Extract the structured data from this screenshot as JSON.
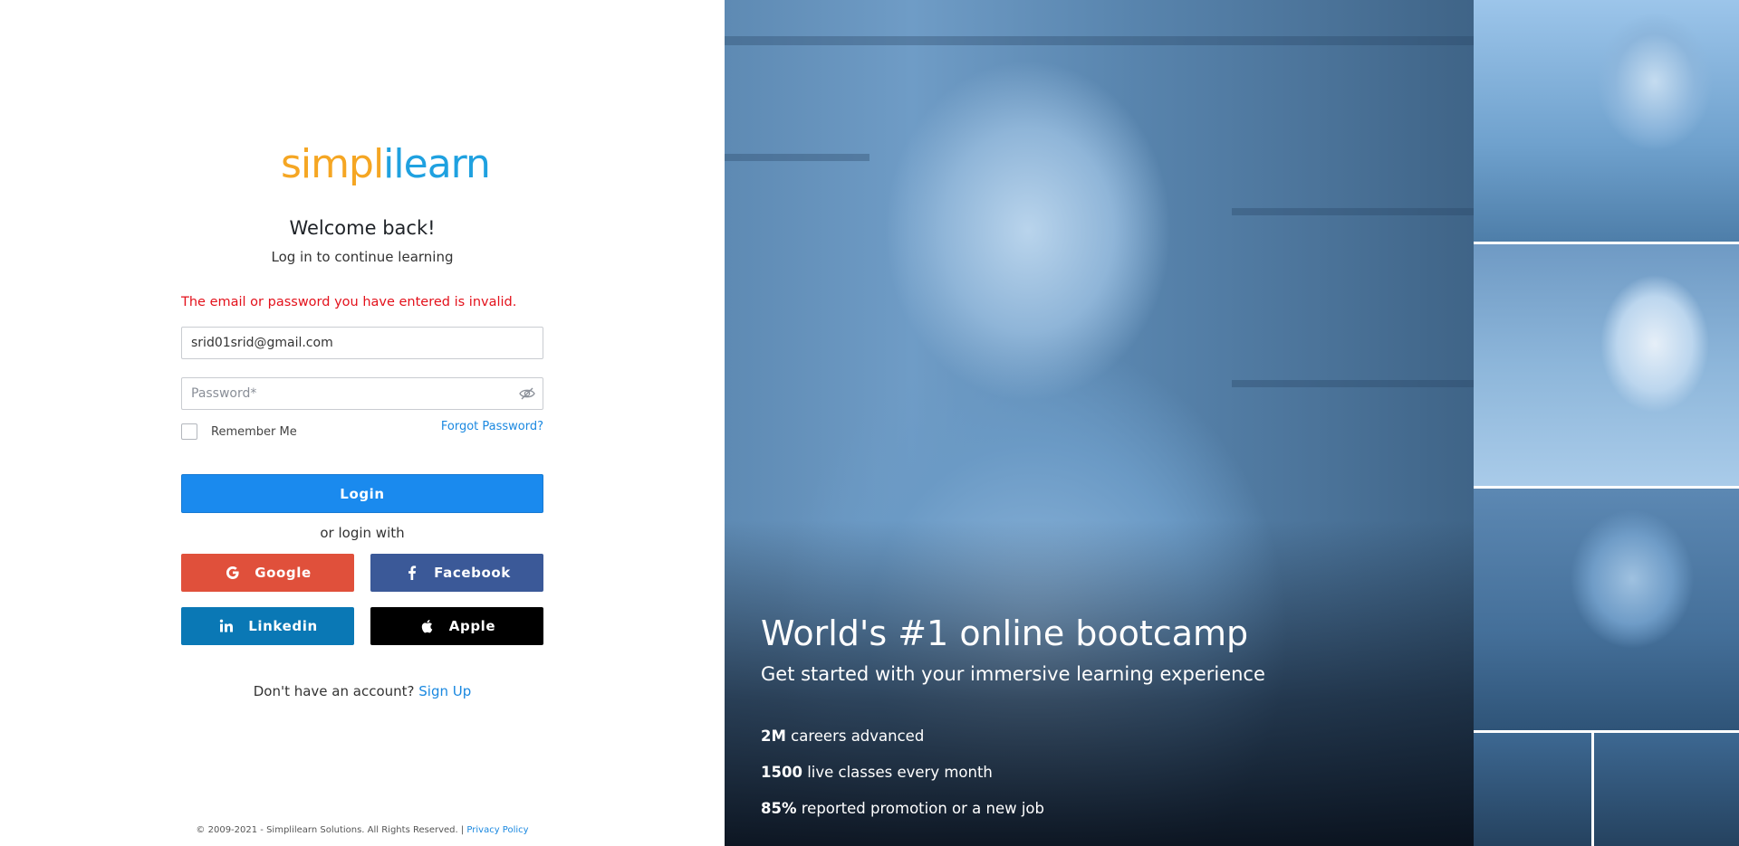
{
  "brand": {
    "logo_part1": "simpl",
    "logo_part2": "ilearn",
    "orange": "#f5a623",
    "blue": "#1fa1e0"
  },
  "login": {
    "heading": "Welcome back!",
    "subheading": "Log in to continue learning",
    "error_message": "The email or password you have entered is invalid.",
    "email_value": "srid01srid@gmail.com",
    "password_placeholder": "Password*",
    "remember_label": "Remember Me",
    "forgot_label": "Forgot Password?",
    "login_button": "Login",
    "or_text": "or login with"
  },
  "social": {
    "google": "Google",
    "facebook": "Facebook",
    "linkedin": "Linkedin",
    "apple": "Apple"
  },
  "signup": {
    "prompt": "Don't have an account?",
    "link": "Sign Up"
  },
  "footer": {
    "copyright": "© 2009-2021 - Simplilearn Solutions. All Rights Reserved. |",
    "privacy": "Privacy Policy"
  },
  "hero": {
    "title": "World's #1 online bootcamp",
    "subtitle": "Get started with your immersive learning experience",
    "stats": [
      {
        "value": "2M",
        "label": "careers advanced"
      },
      {
        "value": "1500",
        "label": "live classes every month"
      },
      {
        "value": "85%",
        "label": "reported promotion or a new job"
      }
    ]
  },
  "colors": {
    "error": "#e3111b",
    "login_button": "#1a8aee",
    "google": "#e0503b",
    "facebook": "#3b5998",
    "linkedin": "#0a78b5",
    "apple": "#000000",
    "link": "#1a88e0"
  },
  "icons": {
    "password_toggle": "eye-slash-icon",
    "google": "google-icon",
    "facebook": "facebook-icon",
    "linkedin": "linkedin-icon",
    "apple": "apple-icon"
  }
}
